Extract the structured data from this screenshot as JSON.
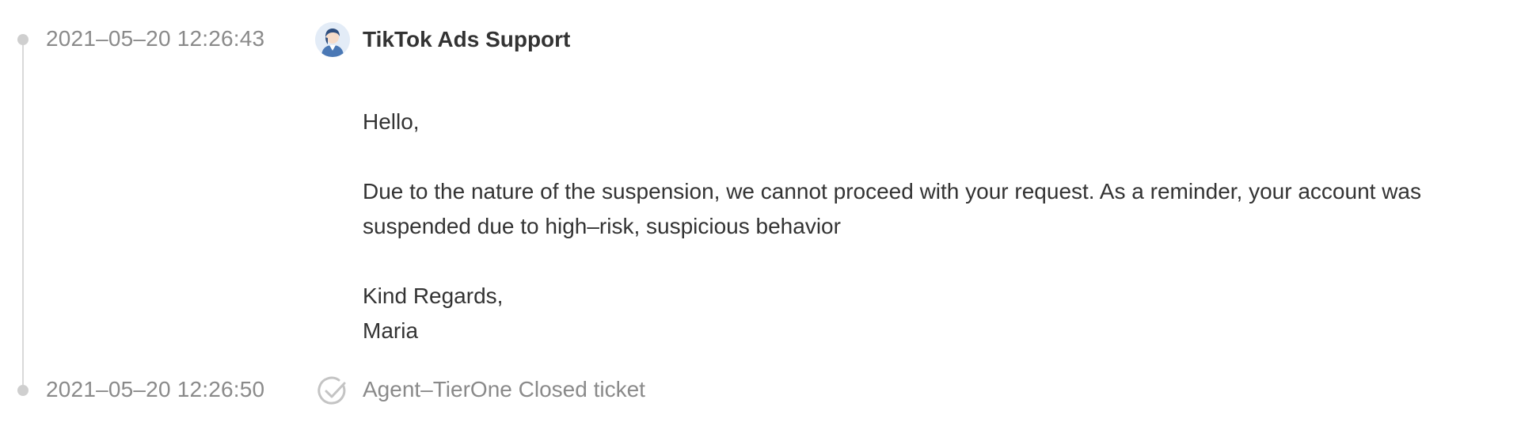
{
  "events": [
    {
      "timestamp": "2021–05–20 12:26:43",
      "sender": "TikTok Ads Support",
      "message": {
        "greeting": "Hello,",
        "body": "Due to the nature of the suspension, we cannot proceed with your request. As a reminder, your account was suspended due to high–risk, suspicious behavior",
        "closing": "Kind Regards,",
        "signature": "Maria"
      }
    },
    {
      "timestamp": "2021–05–20 12:26:50",
      "text": "Agent–TierOne Closed ticket"
    }
  ],
  "colors": {
    "timeline": "#d9d9d9",
    "dot": "#cfcfcf",
    "muted_text": "#8a8a8a",
    "text": "#333333",
    "avatar_bg": "#e3ecf7",
    "avatar_accent": "#4a78b5"
  },
  "icons": {
    "avatar": "support-agent-avatar",
    "closed": "check-circle-icon"
  }
}
